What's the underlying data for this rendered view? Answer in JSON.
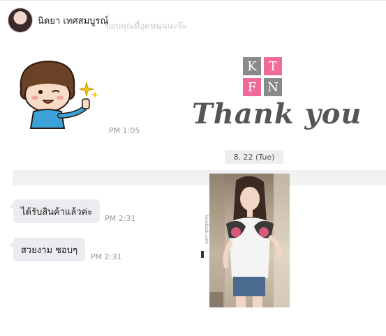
{
  "header": {
    "sender_name": "นิดยา เทศสมบูรณ์",
    "ghost_text": "ขอบคุณที่อุดหนุนนะจ๊ะ"
  },
  "messages": {
    "sticker_time": "PM 1:05",
    "date_divider": "8. 22 (Tue)",
    "m1_text": "ได้รับสินค้าแล้วค่ะ",
    "m1_time": "PM 2:31",
    "m2_text": "สวยงาม ชอบๆ",
    "m2_time": "PM 2:31"
  },
  "image_card": {
    "logo_letters": [
      "K",
      "T",
      "F",
      "N"
    ],
    "thank_you": "Thank  you",
    "side_tag": "facebook.com"
  },
  "colors": {
    "logo_gray": "#8a8a8a",
    "logo_pink": "#f06a9b",
    "bubble_bg": "#ebecef",
    "time_text": "#9a9a9a"
  }
}
